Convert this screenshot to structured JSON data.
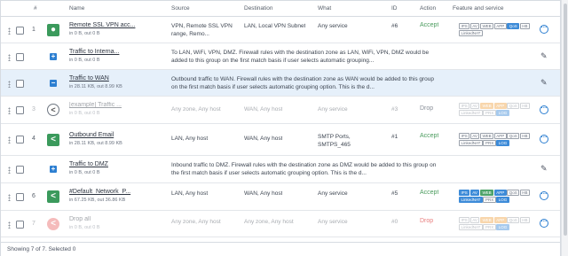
{
  "headers": {
    "num": "#",
    "name": "Name",
    "source": "Source",
    "destination": "Destination",
    "what": "What",
    "id": "ID",
    "action": "Action",
    "features": "Feature and service"
  },
  "rows": [
    {
      "num": "1",
      "name": "Remote SSL VPN acc...",
      "traffic": "in 0 B, out 0 B",
      "source": "VPN, Remote SSL VPN range, Remo...",
      "destination": "LAN, Local VPN Subnet",
      "what": "Any service",
      "id": "#6",
      "action": "Accept",
      "badges": [
        "IPS",
        "AV",
        "WEB",
        "APP",
        "QoS",
        "HB",
        "LinkedNAT"
      ],
      "menu_icon": "more-options-icon"
    },
    {
      "name": "Traffic to Interna...",
      "traffic": "in 0 B, out 0 B",
      "description": "To LAN, WiFi, VPN, DMZ. Firewall rules with the destination zone as LAN, WiFi, VPN, DMZ would be added to this group on the first match basis if user selects automatic grouping...",
      "edit_icon": "pencil-icon"
    },
    {
      "name": "Traffic to WAN",
      "traffic": "in 28.11 KB, out 8.99 KB",
      "description": "Outbound traffic to WAN. Firewall rules with the destination zone as WAN would be added to this group on the first match basis if user selects automatic grouping option. This is the d...",
      "edit_icon": "pencil-icon"
    },
    {
      "num": "3",
      "name": "[example] Traffic ...",
      "traffic": "in 0 B, out 0 B",
      "source": "Any zone, Any host",
      "destination": "WAN, Any host",
      "what": "Any service",
      "id": "#3",
      "action": "Drop",
      "badges": [
        "IPS",
        "AV",
        "WEB",
        "APP",
        "QoS",
        "HB",
        "LinkedNAT",
        "PRX",
        "LOG"
      ]
    },
    {
      "num": "4",
      "name": "Outbound Email",
      "traffic": "in 28.11 KB, out 8.99 KB",
      "source": "LAN, Any host",
      "destination": "WAN, Any host",
      "what": "SMTP Ports, SMTPS_465",
      "id": "#1",
      "action": "Accept",
      "badges": [
        "IPS",
        "AV",
        "WEB",
        "APP",
        "QoS",
        "HB",
        "LinkedNAT",
        "PRX",
        "LOG"
      ]
    },
    {
      "name": "Traffic to DMZ",
      "traffic": "in 0 B, out 0 B",
      "description": "Inbound traffic to DMZ. Firewall rules with the destination zone as DMZ would be added to this group on the first match basis if user selects automatic grouping option. This is the d...",
      "edit_icon": "pencil-icon"
    },
    {
      "num": "6",
      "name": "#Default_Network_P...",
      "traffic": "in 67.25 KB, out 36.86 KB",
      "source": "LAN, Any host",
      "destination": "WAN, Any host",
      "what": "Any service",
      "id": "#5",
      "action": "Accept",
      "badges": [
        "IPS",
        "AV",
        "WEB",
        "APP",
        "QoS",
        "HB",
        "LinkedNAT",
        "PRX",
        "LOG"
      ]
    },
    {
      "num": "7",
      "name": "Drop all",
      "traffic": "in 0 B, out 0 B",
      "source": "Any zone, Any host",
      "destination": "Any zone, Any host",
      "what": "Any service",
      "id": "#0",
      "action": "Drop",
      "badges": [
        "IPS",
        "AV",
        "WEB",
        "APP",
        "QoS",
        "HB",
        "LinkedNAT",
        "PRX",
        "LOG"
      ]
    }
  ],
  "footer": {
    "status": "Showing 7 of 7. Selected 0"
  },
  "colors": {
    "accept": "#4a9b5d",
    "drop": "#8a9099",
    "accent": "#2d7fd1",
    "selected_row": "#e6f0fa"
  }
}
